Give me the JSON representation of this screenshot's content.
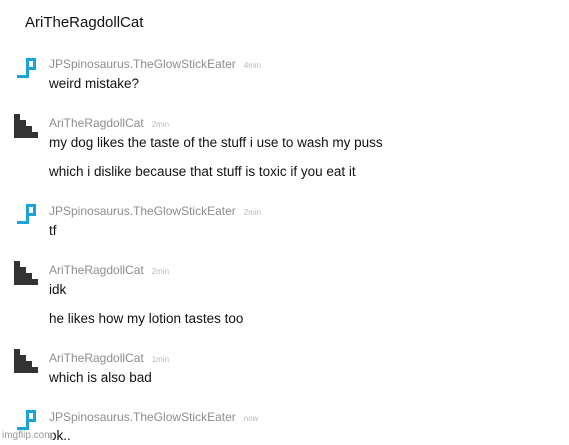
{
  "chat": {
    "title": "AriTheRagdollCat",
    "messages": [
      {
        "user": "JPSpinosaurus.TheGlowStickEater",
        "time": "4min",
        "avatar_icon": "blue-pixel-avatar-icon",
        "lines": [
          "weird mistake?"
        ]
      },
      {
        "user": "AriTheRagdollCat",
        "time": "2min",
        "avatar_icon": "black-staircase-avatar-icon",
        "lines": [
          "my dog likes the taste of the stuff i use to wash my puss",
          "which i dislike because that stuff is toxic if you eat it"
        ]
      },
      {
        "user": "JPSpinosaurus.TheGlowStickEater",
        "time": "2min",
        "avatar_icon": "blue-pixel-avatar-icon",
        "lines": [
          "tf"
        ]
      },
      {
        "user": "AriTheRagdollCat",
        "time": "2min",
        "avatar_icon": "black-staircase-avatar-icon",
        "lines": [
          "idk",
          "he likes how my lotion tastes too"
        ]
      },
      {
        "user": "AriTheRagdollCat",
        "time": "1min",
        "avatar_icon": "black-staircase-avatar-icon",
        "lines": [
          "which is also bad"
        ]
      },
      {
        "user": "JPSpinosaurus.TheGlowStickEater",
        "time": "now",
        "avatar_icon": "blue-pixel-avatar-icon",
        "lines": [
          "ok.."
        ]
      }
    ]
  },
  "watermark": "imgflip.com",
  "colors": {
    "blue_avatar": "#1aa3d9",
    "dark_avatar": "#333333",
    "username": "#8d8d8d",
    "timestamp": "#b9b9b9"
  }
}
